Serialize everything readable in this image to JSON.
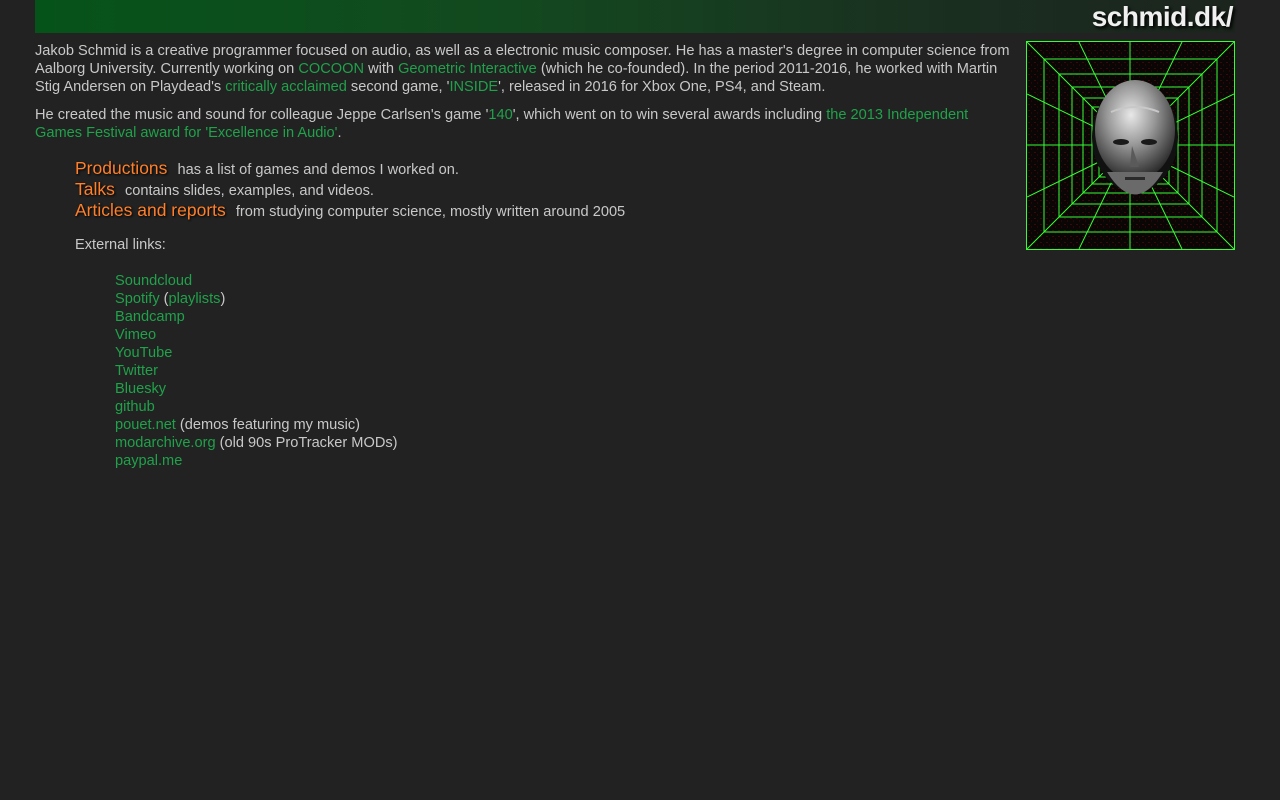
{
  "header": {
    "site_title": "schmid.dk/"
  },
  "intro": {
    "p1_a": "Jakob Schmid is a creative programmer focused on audio, as well as a electronic music composer. He has a master's degree in computer science from Aalborg University. Currently working on ",
    "p1_link_cocoon": "COCOON",
    "p1_b": " with ",
    "p1_link_geometric": "Geometric Interactive",
    "p1_c": " (which he co-founded). In the period 2011-2016, he worked with Martin Stig Andersen on Playdead's ",
    "p1_link_acclaimed": "critically acclaimed",
    "p1_d": " second game, '",
    "p1_link_inside": "INSIDE",
    "p1_e": "', released in 2016 for Xbox One, PS4, and Steam.",
    "p2_a": "He created the music and sound for colleague Jeppe Carlsen's game '",
    "p2_link_140": "140",
    "p2_b": "', which went on to win several awards including ",
    "p2_link_award": "the 2013 Independent Games Festival award for 'Excellence in Audio'",
    "p2_c": "."
  },
  "sections": [
    {
      "label": "Productions",
      "desc": "has a list of games and demos I worked on."
    },
    {
      "label": "Talks",
      "desc": "contains slides, examples, and videos."
    },
    {
      "label": "Articles and reports",
      "desc": "from studying computer science, mostly written around 2005"
    }
  ],
  "external": {
    "title": "External links:",
    "soundcloud": "Soundcloud",
    "spotify": "Spotify",
    "spotify_open": " (",
    "playlists": "playlists",
    "spotify_close": ")",
    "bandcamp": "Bandcamp",
    "vimeo": "Vimeo",
    "youtube": "YouTube",
    "twitter": "Twitter",
    "bluesky": "Bluesky",
    "github": "github",
    "pouet": "pouet.net",
    "pouet_note": " (demos featuring my music)",
    "modarchive": "modarchive.org",
    "modarchive_note": " (old 90s ProTracker MODs)",
    "paypal": "paypal.me"
  },
  "colors": {
    "background": "#222222",
    "text": "#c8c8c8",
    "link": "#1fa24a",
    "section_link": "#ff7f2a",
    "grid": "#33ff33"
  },
  "avatar": {
    "icon": "wireframe-tunnel-face-icon"
  }
}
